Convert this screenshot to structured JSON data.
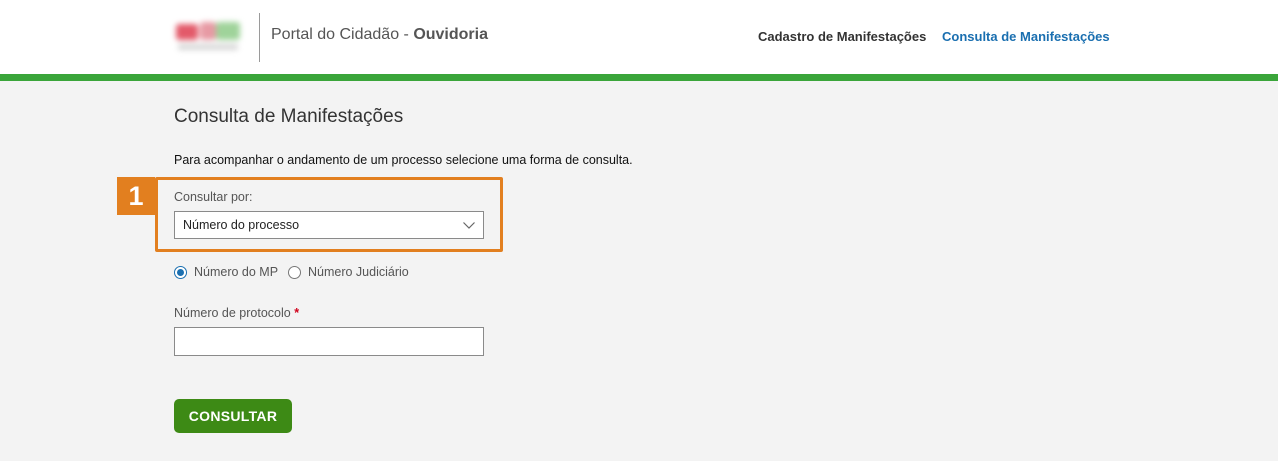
{
  "header": {
    "portal_title_prefix": "Portal do Cidadão - ",
    "portal_title_strong": "Ouvidoria",
    "nav": [
      {
        "label": "Cadastro de Manifestações",
        "active": false
      },
      {
        "label": "Consulta de Manifestações",
        "active": true
      }
    ],
    "accent_color": "#3aa53a",
    "link_color": "#1a6fb0"
  },
  "main": {
    "page_title": "Consulta de Manifestações",
    "instructions": "Para acompanhar o andamento de um processo selecione uma forma de consulta.",
    "step_badge": "1",
    "consultar_por": {
      "label": "Consultar por:",
      "selected": "Número do processo"
    },
    "radio_options": [
      {
        "label": "Número do MP",
        "checked": true
      },
      {
        "label": "Número Judiciário",
        "checked": false
      }
    ],
    "protocolo": {
      "label": "Número de protocolo",
      "required_mark": "*",
      "value": ""
    },
    "submit_label": "CONSULTAR",
    "highlight_color": "#e27f1f",
    "button_color": "#3d8a15"
  }
}
